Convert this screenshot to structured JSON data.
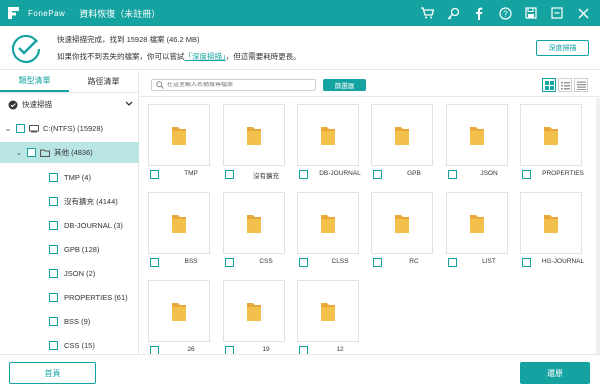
{
  "app": {
    "brand": "FonePaw",
    "title": "資料恢復（未註冊）"
  },
  "title_icons": [
    "cart-icon",
    "key-icon",
    "facebook-icon",
    "help-icon",
    "save-icon",
    "minimize-icon",
    "close-icon"
  ],
  "info": {
    "line1": "快速掃描完成，找到 15928 檔案 (46.2 MB)",
    "line2_prefix": "如果你找不到丟失的檔案，你可以嘗試",
    "line2_link": "「深度掃描」",
    "line2_suffix": "，但這需要耗時更長。",
    "deep_scan_button": "深度掃描"
  },
  "sidebar": {
    "tabs": [
      "類型清單",
      "路徑清單"
    ],
    "active_tab": 0,
    "quick_scan_label": "快速掃描",
    "drive_label": "C:(NTFS) (15928)",
    "folder_label": "其他 (4836)",
    "items": [
      "TMP (4)",
      "沒有擴充 (4144)",
      "DB-JOURNAL (3)",
      "GPB (128)",
      "JSON (2)",
      "PROPERTIES (61)",
      "BSS (9)",
      "CSS (15)"
    ]
  },
  "toolbar": {
    "search_placeholder": "在這里輸入名稱搜尋檔案",
    "filter_button": "篩選器",
    "view_modes": [
      "grid-view-icon",
      "list-view-icon",
      "detail-view-icon"
    ]
  },
  "grid": {
    "items": [
      "TMP",
      "沒有擴充",
      "DB-JOURNAL",
      "GPB",
      "JSON",
      "PROPERTIES",
      "BSS",
      "CSS",
      "CLSS",
      "RC",
      "LIST",
      "HG-JOURNAL",
      "26",
      "19",
      "12"
    ]
  },
  "bottom": {
    "home_button": "首頁",
    "recover_button": "還原"
  },
  "colors": {
    "accent": "#14a3a1",
    "selected_row": "#b9e6e4",
    "folder": "#f3c14b"
  }
}
